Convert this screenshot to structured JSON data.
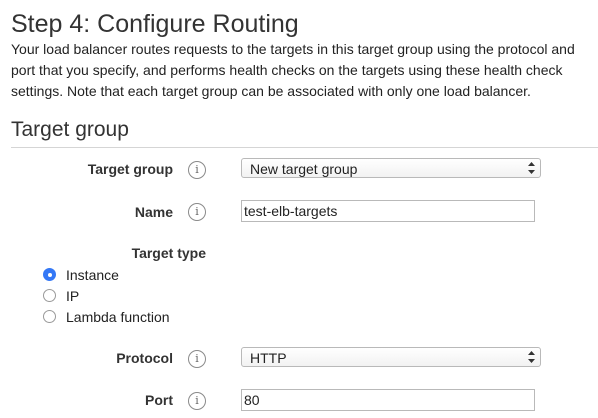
{
  "header": {
    "title": "Step 4: Configure Routing",
    "description": "Your load balancer routes requests to the targets in this target group using the protocol and port that you specify, and performs health checks on the targets using these health check settings. Note that each target group can be associated with only one load balancer."
  },
  "section": {
    "title": "Target group"
  },
  "form": {
    "info_glyph": "i",
    "target_group": {
      "label": "Target group",
      "value": "New target group",
      "icon": "info-icon"
    },
    "name": {
      "label": "Name",
      "value": "test-elb-targets",
      "icon": "info-icon"
    },
    "target_type": {
      "label": "Target type",
      "options": [
        {
          "label": "Instance",
          "checked": true
        },
        {
          "label": "IP",
          "checked": false
        },
        {
          "label": "Lambda function",
          "checked": false
        }
      ]
    },
    "protocol": {
      "label": "Protocol",
      "value": "HTTP",
      "icon": "info-icon"
    },
    "port": {
      "label": "Port",
      "value": "80",
      "icon": "info-icon"
    }
  },
  "colors": {
    "radio_selected": "#3478f6",
    "divider": "#d5d5d5"
  }
}
